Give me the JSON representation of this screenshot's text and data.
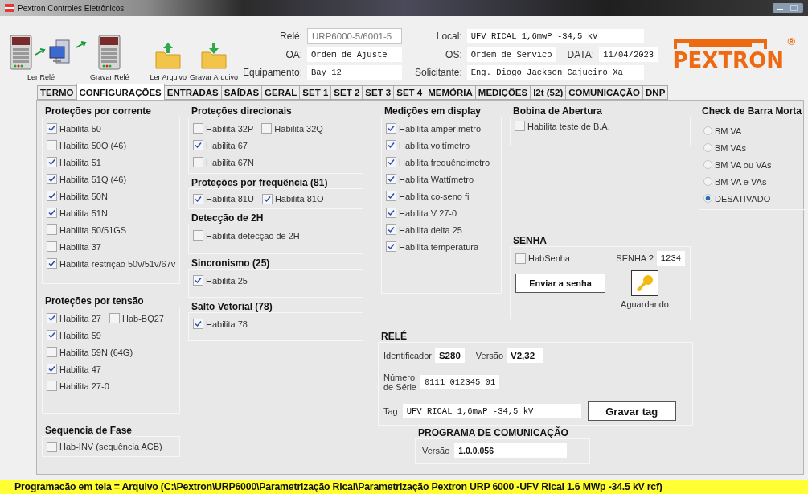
{
  "window": {
    "title": "Pextron Controles Eletrônicos"
  },
  "toolbar": {
    "buttons": [
      {
        "kind": "read_relay",
        "label": "Ler Relé"
      },
      {
        "kind": "write_relay",
        "label": "Gravar Relé"
      },
      {
        "kind": "read_file",
        "label": "Ler Arquivo"
      },
      {
        "kind": "write_file",
        "label": "Gravar Arquivo"
      }
    ]
  },
  "header_fields": {
    "left": [
      {
        "label": "Relé:",
        "value": "URP6000-5/6001-5",
        "disabled": true
      },
      {
        "label": "OA:",
        "value": "Ordem de Ajuste",
        "disabled": false
      },
      {
        "label": "Equipamento:",
        "value": "Bay 12",
        "disabled": false
      }
    ],
    "right": [
      {
        "label": "Local:",
        "value": "UFV RICAL 1,6mwP -34,5 kV"
      },
      {
        "label": "OS:",
        "value": "Ordem de Servico"
      },
      {
        "label": "Solicitante:",
        "value": "Eng. Diogo Jackson Cajueiro Xa"
      }
    ],
    "date": {
      "label": "DATA:",
      "value": "11/04/2023"
    }
  },
  "logo": {
    "text": "PEXTRON",
    "mark": "®"
  },
  "tabs": [
    {
      "label": "TERMO",
      "selected": false
    },
    {
      "label": "CONFIGURAÇÕES",
      "selected": true
    },
    {
      "label": "ENTRADAS",
      "selected": false
    },
    {
      "label": "SAÍDAS",
      "selected": false
    },
    {
      "label": "GERAL",
      "selected": false
    },
    {
      "label": "SET 1",
      "selected": false
    },
    {
      "label": "SET 2",
      "selected": false
    },
    {
      "label": "SET 3",
      "selected": false
    },
    {
      "label": "SET 4",
      "selected": false
    },
    {
      "label": "MEMÓRIA",
      "selected": false
    },
    {
      "label": "MEDIÇÕES",
      "selected": false
    },
    {
      "label": "I2t (52)",
      "selected": false
    },
    {
      "label": "COMUNICAÇÃO",
      "selected": false
    },
    {
      "label": "DNP",
      "selected": false
    }
  ],
  "current_protections": {
    "title": "Proteções por corrente",
    "rows": [
      {
        "options": [
          {
            "label": "Habilita 50",
            "checked": true
          }
        ]
      },
      {
        "options": [
          {
            "label": "Habilita 50Q (46)",
            "checked": false
          }
        ]
      },
      {
        "options": [
          {
            "label": "Habilita 51",
            "checked": true
          }
        ]
      },
      {
        "options": [
          {
            "label": "Habilita 51Q (46)",
            "checked": true
          }
        ]
      },
      {
        "options": [
          {
            "label": "Habilita 50N",
            "checked": true
          }
        ]
      },
      {
        "options": [
          {
            "label": "Habilita 51N",
            "checked": true
          }
        ]
      },
      {
        "options": [
          {
            "label": "Habilita 50/51GS",
            "checked": false
          }
        ]
      },
      {
        "options": [
          {
            "label": "Habilita 37",
            "checked": false
          }
        ]
      },
      {
        "options": [
          {
            "label": "Habilita restrição 50v/51v/67v",
            "checked": true
          }
        ]
      }
    ]
  },
  "voltage_protections": {
    "title": "Proteções por tensão",
    "rows": [
      {
        "options": [
          {
            "label": "Habilita 27",
            "checked": true
          },
          {
            "label": "Hab-BQ27",
            "checked": false
          }
        ]
      },
      {
        "options": [
          {
            "label": "Habilita 59",
            "checked": true
          }
        ]
      },
      {
        "options": [
          {
            "label": "Habilita 59N (64G)",
            "checked": false
          }
        ]
      },
      {
        "options": [
          {
            "label": "Habilita 47",
            "checked": true
          }
        ]
      },
      {
        "options": [
          {
            "label": "Habilita 27-0",
            "checked": false
          }
        ]
      }
    ]
  },
  "phase_sequence": {
    "title": "Sequencia de Fase",
    "rows": [
      {
        "options": [
          {
            "label": "Hab-INV (sequência ACB)",
            "checked": false
          }
        ]
      }
    ]
  },
  "directional_protections": {
    "title": "Proteções direcionais",
    "rows": [
      {
        "options": [
          {
            "label": "Habilita 32P",
            "checked": false
          },
          {
            "label": "Habilita 32Q",
            "checked": false
          }
        ]
      },
      {
        "options": [
          {
            "label": "Habilita 67",
            "checked": true
          }
        ]
      },
      {
        "options": [
          {
            "label": "Habilita 67N",
            "checked": false
          }
        ]
      }
    ]
  },
  "frequency_protections": {
    "title": "Proteções por frequência (81)",
    "rows": [
      {
        "options": [
          {
            "label": "Habilita 81U",
            "checked": true
          },
          {
            "label": "Habilita 81O",
            "checked": true
          }
        ]
      }
    ]
  },
  "detection_2h": {
    "title": "Detecção de 2H",
    "rows": [
      {
        "options": [
          {
            "label": "Habilita detecção de 2H",
            "checked": false
          }
        ]
      }
    ]
  },
  "synchronism": {
    "title": "Sincronismo (25)",
    "rows": [
      {
        "options": [
          {
            "label": "Habilita 25",
            "checked": true
          }
        ]
      }
    ]
  },
  "vector_jump": {
    "title": "Salto Vetorial (78)",
    "rows": [
      {
        "options": [
          {
            "label": "Habilita 78",
            "checked": true
          }
        ]
      }
    ]
  },
  "display_measurements": {
    "title": "Medições em display",
    "rows": [
      {
        "options": [
          {
            "label": "Habilita amperímetro",
            "checked": true
          }
        ]
      },
      {
        "options": [
          {
            "label": "Habilita voltímetro",
            "checked": true
          }
        ]
      },
      {
        "options": [
          {
            "label": "Habilita frequêncimetro",
            "checked": true
          }
        ]
      },
      {
        "options": [
          {
            "label": "Habilita Wattímetro",
            "checked": true
          }
        ]
      },
      {
        "options": [
          {
            "label": "Habilita co-seno fi",
            "checked": true
          }
        ]
      },
      {
        "options": [
          {
            "label": "Habilita V 27-0",
            "checked": true
          }
        ]
      },
      {
        "options": [
          {
            "label": "Habilita delta 25",
            "checked": true
          }
        ]
      },
      {
        "options": [
          {
            "label": "Habilita temperatura",
            "checked": true
          }
        ]
      }
    ]
  },
  "trip_coil": {
    "title": "Bobina de Abertura",
    "rows": [
      {
        "options": [
          {
            "label": "Habilita teste de B.A.",
            "checked": false
          }
        ]
      }
    ]
  },
  "password": {
    "title": "SENHA",
    "enable": {
      "label": "HabSenha",
      "checked": false
    },
    "field_label": "SENHA ?",
    "value": "1234",
    "button": "Enviar a senha",
    "status": "Aguardando"
  },
  "dead_bus_check": {
    "title": "Check de Barra Morta",
    "options": [
      {
        "label": "BM VA",
        "selected": false
      },
      {
        "label": "BM VAs",
        "selected": false
      },
      {
        "label": "BM VA ou VAs",
        "selected": false
      },
      {
        "label": "BM VA e VAs",
        "selected": false
      },
      {
        "label": "DESATIVADO",
        "selected": true
      }
    ]
  },
  "relay": {
    "title": "RELÉ",
    "identifier": {
      "label": "Identificador",
      "value": "S280"
    },
    "version": {
      "label": "Versão",
      "value": "V2,32"
    },
    "serial": {
      "label": "Número de Série",
      "value": "0111_012345_01"
    },
    "tag": {
      "label": "Tag",
      "value": "UFV RICAL 1,6mwP -34,5 kV"
    },
    "button": "Gravar tag"
  },
  "communication_program": {
    "title": "PROGRAMA DE COMUNICAÇÃO",
    "version": {
      "label": "Versão",
      "value": "1.0.0.056"
    }
  },
  "status_bar": {
    "text": "Programacão em tela = Arquivo (C:\\Pextron\\URP6000\\Parametrização Rical\\Parametrização Pextron URP 6000 -UFV Rical 1.6 MWp -34.5 kV rcf)"
  }
}
